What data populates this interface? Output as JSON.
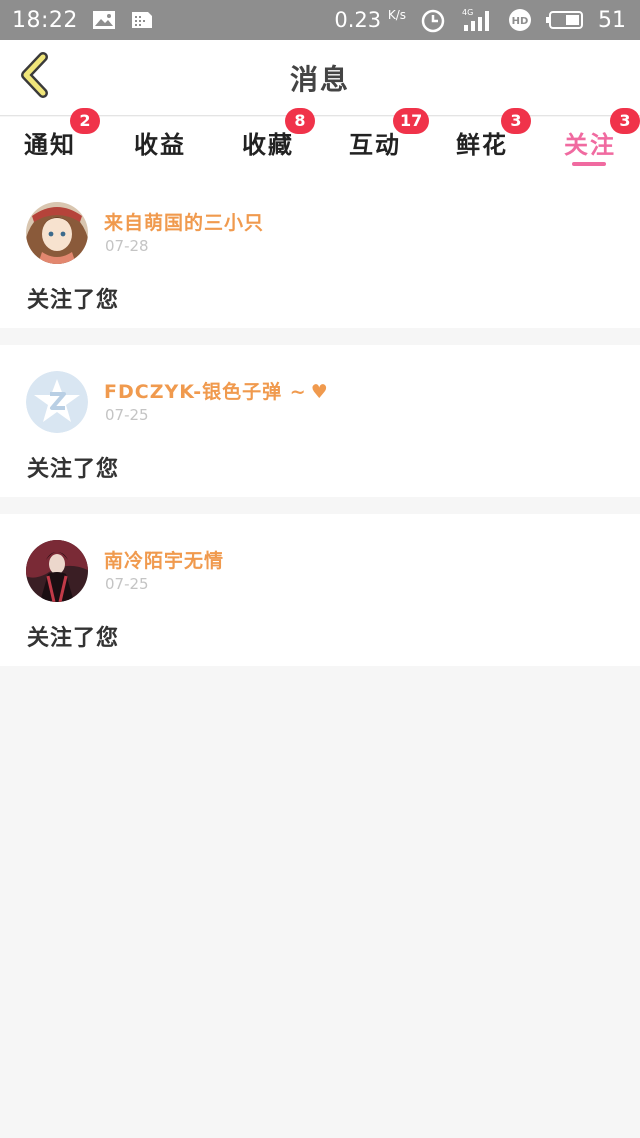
{
  "status_bar": {
    "time": "18:22",
    "speed": "0.23",
    "speed_unit": "K/s",
    "battery": "51",
    "icons": [
      "image-icon",
      "sim-card-icon",
      "alarm-icon",
      "signal-4g-icon",
      "hd-icon",
      "battery-icon"
    ]
  },
  "header": {
    "title": "消息",
    "back_icon": "chevron-left-icon"
  },
  "tabs": [
    {
      "label": "通知",
      "badge": "2"
    },
    {
      "label": "收益",
      "badge": ""
    },
    {
      "label": "收藏",
      "badge": "8"
    },
    {
      "label": "互动",
      "badge": "17"
    },
    {
      "label": "鲜花",
      "badge": "3"
    },
    {
      "label": "关注",
      "badge": "3",
      "active": true
    }
  ],
  "notifications": [
    {
      "username": "来自萌国的三小只",
      "date": "07-28",
      "message": "关注了您",
      "heart": ""
    },
    {
      "username": "FDCZYK-银色子弹 ~",
      "date": "07-25",
      "message": "关注了您",
      "heart": "♥"
    },
    {
      "username": "南冷陌宇无情",
      "date": "07-25",
      "message": "关注了您",
      "heart": ""
    }
  ],
  "colors": {
    "accent_pink": "#f06aa0",
    "badge_red": "#f0334a",
    "username_orange": "#f09a4e",
    "status_bar": "#8e8e8e"
  }
}
